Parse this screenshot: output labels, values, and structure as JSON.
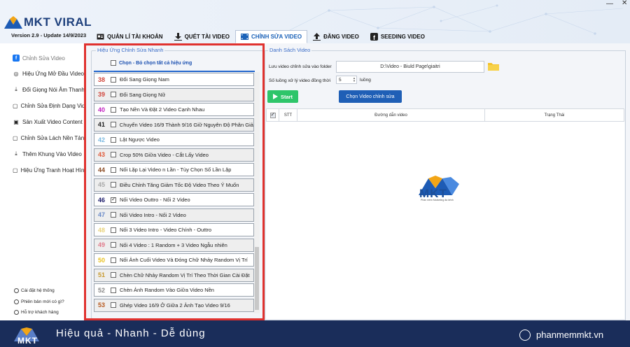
{
  "app": {
    "logo_text": "MKT VIRAL",
    "version": "Version 2.9 - Update 14/9/2023",
    "minimize_glyph": "—",
    "close_glyph": "✕"
  },
  "tabs": [
    {
      "label": "QUẢN LÍ TÀI KHOẢN",
      "icon": "id-card-icon"
    },
    {
      "label": "QUÉT TÀI VIDEO",
      "icon": "download-icon"
    },
    {
      "label": "CHỈNH SỬA VIDEO",
      "icon": "film-icon",
      "active": true
    },
    {
      "label": "ĐĂNG VIDEO",
      "icon": "upload-icon"
    },
    {
      "label": "SEEDING VIDEO",
      "icon": "facebook-icon"
    }
  ],
  "sidebar": {
    "items": [
      {
        "label": "Chỉnh Sửa Video",
        "icon": "f",
        "active": true
      },
      {
        "label": "Hiệu Ứng Mở Đầu Video",
        "icon": "◎"
      },
      {
        "label": "Đổi Giọng Nói Âm Thanh",
        "icon": "⤓"
      },
      {
        "label": "Chỉnh Sửa Định Dạng Video",
        "icon": "▢"
      },
      {
        "label": "Sản Xuất Video Content",
        "icon": "▣"
      },
      {
        "label": "Chỉnh Sửa Lách Nền Tảng",
        "icon": "▢"
      },
      {
        "label": "Thêm Khung Vào Video",
        "icon": "⤓"
      },
      {
        "label": "Hiệu Ứng Tranh Hoạt Hình",
        "icon": "▢"
      }
    ],
    "footer": [
      {
        "label": "Cài đặt hệ thống"
      },
      {
        "label": "Phiên bản mới có gì?"
      },
      {
        "label": "Hỗ trợ khách hàng"
      }
    ]
  },
  "effects": {
    "legend": "Hiệu Ứng Chỉnh Sửa Nhanh",
    "select_all": "Chọn - Bỏ chọn tất cả hiệu ứng",
    "items": [
      {
        "num": "38",
        "label": "Đổi Sang Giọng Nam",
        "color": "#d0443a",
        "checked": false
      },
      {
        "num": "39",
        "label": "Đổi Sang Giọng Nữ",
        "color": "#d0443a",
        "checked": false
      },
      {
        "num": "40",
        "label": "Tạo Nền Và Đặt 2 Video Cạnh Nhau",
        "color": "#c020c0",
        "checked": false
      },
      {
        "num": "41",
        "label": "Chuyển Video 16/9 Thành 9/16 Giữ Nguyên Độ Phân Giải",
        "color": "#222222",
        "checked": false
      },
      {
        "num": "42",
        "label": "Lật Ngược Video",
        "color": "#7ab8e0",
        "checked": false
      },
      {
        "num": "43",
        "label": "Crop 50% Giữa Video - Cắt Lấy Video",
        "color": "#e05a3a",
        "checked": false
      },
      {
        "num": "44",
        "label": "Nối Lặp Lại Video n Lần - Tùy Chọn Số Lần Lặp",
        "color": "#8a4a22",
        "checked": false
      },
      {
        "num": "45",
        "label": "Điều Chỉnh Tăng Giảm Tốc Độ Video Theo Ý Muốn",
        "color": "#a8a8a8",
        "checked": false
      },
      {
        "num": "46",
        "label": "Nối Video Outtro - Nối 2 Video",
        "color": "#1a1a6a",
        "checked": true
      },
      {
        "num": "47",
        "label": "Nối Video Intro - Nối 2 Video",
        "color": "#6a8ac8",
        "checked": false
      },
      {
        "num": "48",
        "label": "Nối 3 Video Intro - Video Chính - Outtro",
        "color": "#e8d27a",
        "checked": false
      },
      {
        "num": "49",
        "label": "Nối 4 Video : 1 Random  + 3 Video Ngẫu nhiên",
        "color": "#e07a8a",
        "checked": false
      },
      {
        "num": "50",
        "label": "Nối Ảnh Cuối Video Và Đóng Chữ Nhảy Random Vị Trí",
        "color": "#e8c020",
        "checked": false
      },
      {
        "num": "51",
        "label": "Chèn Chữ Nhảy Random Vị Trí Theo Thời Gian Cài Đặt",
        "color": "#c89a30",
        "checked": false
      },
      {
        "num": "52",
        "label": "Chèn Ảnh Random Vào Giữa Video Nền",
        "color": "#888888",
        "checked": false
      },
      {
        "num": "53",
        "label": "Ghép Video 16/9 Ở Giữa 2 Ảnh Tạo Video 9/16",
        "color": "#b85a20",
        "checked": false
      }
    ]
  },
  "video_list": {
    "legend": "Danh Sách Video",
    "save_label": "Lưu video chỉnh sửa vào folder",
    "save_path": "D:\\Video - Biuld Page\\giaitri",
    "thread_label": "Số luồng xử lý video đồng thời",
    "thread_value": "5",
    "thread_unit": "luồng",
    "start_label": "Start",
    "choose_label": "Chọn Video chỉnh sửa",
    "columns": [
      "STT",
      "Đường dẫn video",
      "Trạng Thái"
    ],
    "logo_text": "MKT",
    "logo_sub": "Phần mềm Marketing đa kênh"
  },
  "footer": {
    "logo_text": "MKT",
    "slogan": "Hiệu quả - Nhanh  - Dễ dùng",
    "site": "phanmemmkt.vn"
  }
}
